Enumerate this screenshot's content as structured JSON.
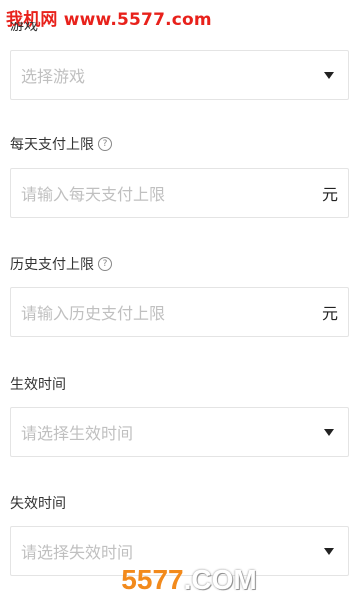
{
  "watermark_top": "我机网 www.5577.com",
  "watermark_bottom": {
    "num": "5577",
    "com": ".COM"
  },
  "form": {
    "game_label_partial": "游戏",
    "game_placeholder": "选择游戏",
    "daily_limit_label": "每天支付上限",
    "daily_limit_placeholder": "请输入每天支付上限",
    "daily_limit_unit": "元",
    "history_limit_label": "历史支付上限",
    "history_limit_placeholder": "请输入历史支付上限",
    "history_limit_unit": "元",
    "effective_time_label": "生效时间",
    "effective_time_placeholder": "请选择生效时间",
    "expiry_time_label": "失效时间",
    "expiry_time_placeholder": "请选择失效时间",
    "help_glyph": "?"
  },
  "colors": {
    "watermark_red": "#e8211b",
    "watermark_orange": "#f28a1c",
    "placeholder": "#c0c0c0",
    "border": "#e4e4e4"
  },
  "icons": [
    "help-icon",
    "dropdown-caret-icon"
  ]
}
